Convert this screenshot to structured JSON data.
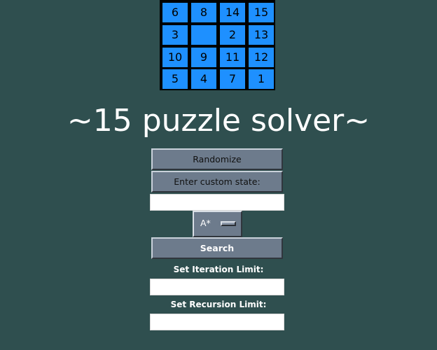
{
  "board": {
    "tiles": [
      "6",
      "8",
      "14",
      "15",
      "3",
      "",
      "2",
      "13",
      "10",
      "9",
      "11",
      "12",
      "5",
      "4",
      "7",
      "1"
    ]
  },
  "title": "~15 puzzle solver~",
  "buttons": {
    "randomize": "Randomize",
    "custom_state": "Enter custom state:",
    "search": "Search"
  },
  "custom_state_input": {
    "value": ""
  },
  "algorithm_selector": {
    "selected": "A*"
  },
  "iteration_limit": {
    "label": "Set Iteration Limit:",
    "value": ""
  },
  "recursion_limit": {
    "label": "Set Recursion Limit:",
    "value": ""
  },
  "colors": {
    "background": "#2f4f4f",
    "tile": "#1e90ff",
    "button": "#6d7b8c"
  }
}
